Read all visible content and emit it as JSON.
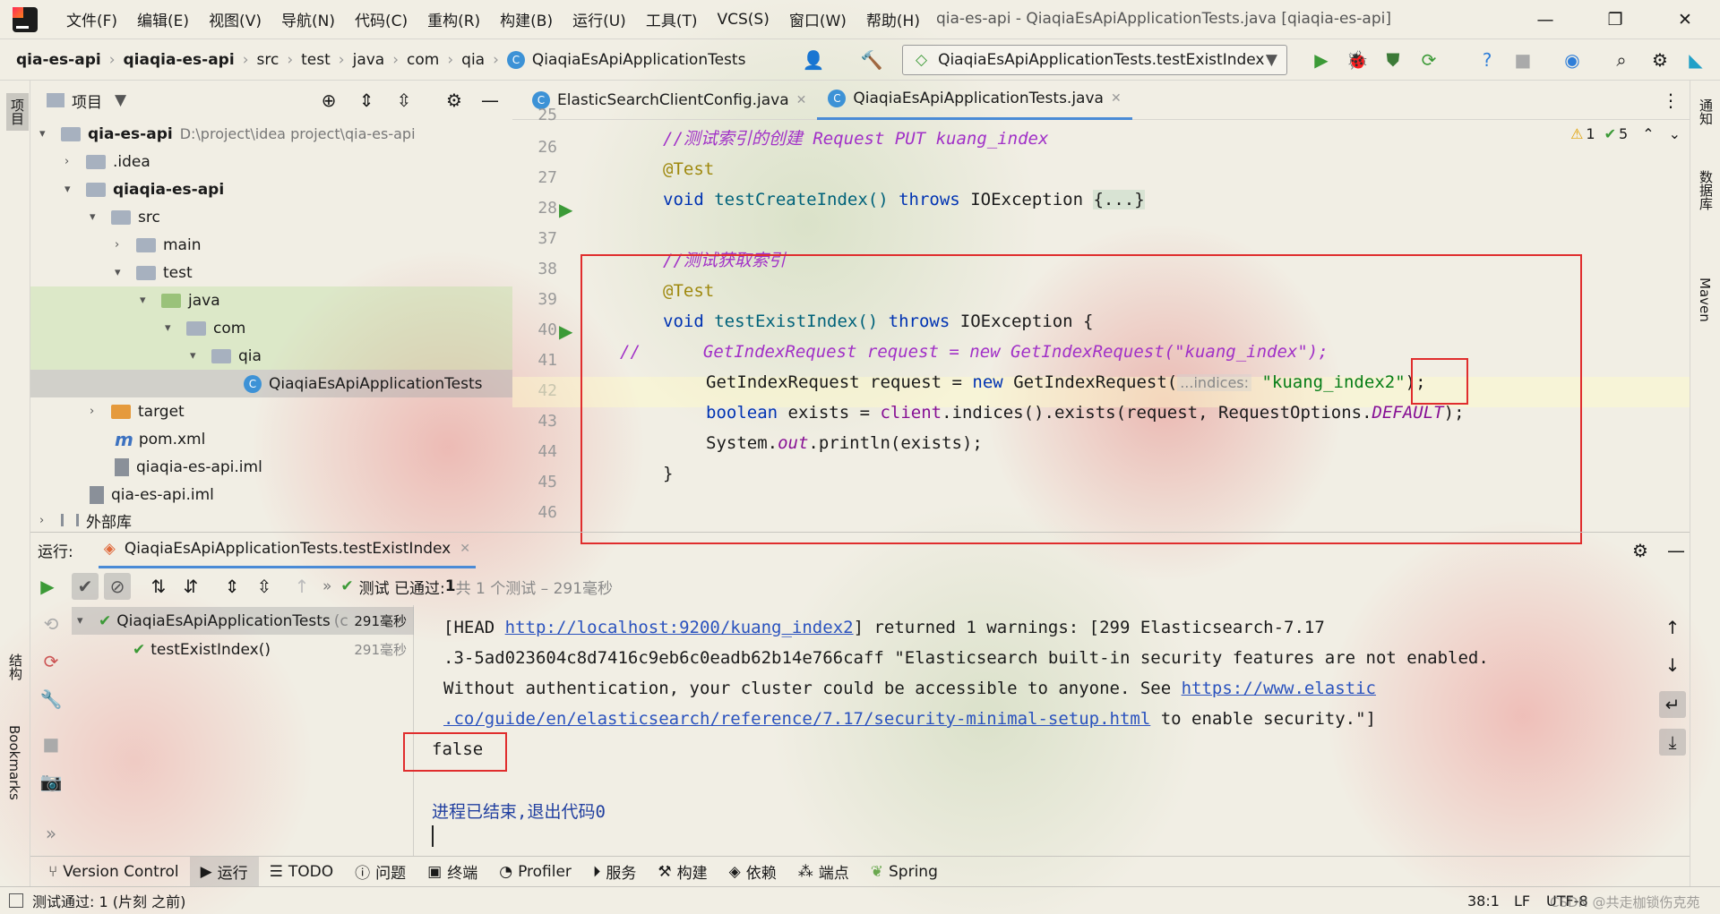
{
  "menu": [
    "文件(F)",
    "编辑(E)",
    "视图(V)",
    "导航(N)",
    "代码(C)",
    "重构(R)",
    "构建(B)",
    "运行(U)",
    "工具(T)",
    "VCS(S)",
    "窗口(W)",
    "帮助(H)"
  ],
  "window_title": "qia-es-api - QiaqiaEsApiApplicationTests.java [qiaqia-es-api]",
  "breadcrumb": [
    "qia-es-api",
    "qiaqia-es-api",
    "src",
    "test",
    "java",
    "com",
    "qia",
    "QiaqiaEsApiApplicationTests"
  ],
  "run_config": "QiaqiaEsApiApplicationTests.testExistIndex",
  "project_panel": {
    "title": "项目"
  },
  "tree": [
    {
      "label": "qia-es-api",
      "path": "D:\\project\\idea project\\qia-es-api"
    },
    {
      "label": ".idea"
    },
    {
      "label": "qiaqia-es-api"
    },
    {
      "label": "src"
    },
    {
      "label": "main"
    },
    {
      "label": "test"
    },
    {
      "label": "java"
    },
    {
      "label": "com"
    },
    {
      "label": "qia"
    },
    {
      "label": "QiaqiaEsApiApplicationTests"
    },
    {
      "label": "target"
    },
    {
      "label": "pom.xml"
    },
    {
      "label": "qiaqia-es-api.iml"
    },
    {
      "label": "qia-es-api.iml"
    },
    {
      "label": "外部库"
    }
  ],
  "tabs": [
    {
      "label": "ElasticSearchClientConfig.java"
    },
    {
      "label": "QiaqiaEsApiApplicationTests.java"
    }
  ],
  "inspections": {
    "warnings": "1",
    "ok": "5"
  },
  "line_numbers": [
    "25",
    "26",
    "27",
    "28",
    "37",
    "38",
    "39",
    "40",
    "41",
    "42",
    "43",
    "44",
    "45",
    "46"
  ],
  "code": {
    "l26": "//测试索引的创建 Request PUT kuang_index",
    "l27": "@Test",
    "l28_a": "void ",
    "l28_b": "testCreateIndex() ",
    "l28_c": "throws ",
    "l28_d": "IOException ",
    "l28_e": "{...}",
    "l38": "//测试获取索引",
    "l39": "@Test",
    "l40_a": "void ",
    "l40_b": "testExistIndex() ",
    "l40_c": "throws ",
    "l40_d": "IOException {",
    "l41_a": "//",
    "l41_b": "GetIndexRequest request = new GetIndexRequest(\"kuang_index\");",
    "l42_a": "GetIndexRequest request = ",
    "l42_b": "new ",
    "l42_c": "GetIndexRequest(",
    "l42_hint": "...indices:",
    "l42_d": "\"kuang_index2\"",
    "l42_e": ");",
    "l43_a": "boolean ",
    "l43_b": "exists = ",
    "l43_c": "client",
    "l43_d": ".indices().exists(request, RequestOptions.",
    "l43_e": "DEFAULT",
    "l43_f": ");",
    "l44_a": "System.",
    "l44_b": "out",
    "l44_c": ".println(exists);",
    "l45": "}"
  },
  "run": {
    "label": "运行:",
    "tab": "QiaqiaEsApiApplicationTests.testExistIndex",
    "status_a": "测试 已通过: ",
    "status_b": "1",
    "status_c": "共 1 个测试 – 291毫秒",
    "tests": [
      {
        "name": "QiaqiaEsApiApplicationTests",
        "extra": "(c",
        "time": "291毫秒"
      },
      {
        "name": "testExistIndex()",
        "time": "291毫秒"
      }
    ]
  },
  "console": {
    "l1_a": "[HEAD ",
    "l1_link": "http://localhost:9200/kuang_index2",
    "l1_b": "] returned 1 warnings: [299 Elasticsearch-7.17",
    "l2": ".3-5ad023604c8d7416c9eb6c0eadb62b14e766caff \"Elasticsearch built-in security features are not enabled.",
    "l3_a": "Without authentication, your cluster could be accessible to anyone. See ",
    "l3_link": "https://www.elastic",
    "l4_link": ".co/guide/en/elasticsearch/reference/7.17/security-minimal-setup.html",
    "l4_b": " to enable security.\"]",
    "l5": "false",
    "l6": "进程已结束,退出代码0"
  },
  "bottom_tabs": [
    "Version Control",
    "运行",
    "TODO",
    "问题",
    "终端",
    "Profiler",
    "服务",
    "构建",
    "依赖",
    "端点",
    "Spring"
  ],
  "status_bar": {
    "left": "测试通过: 1 (片刻 之前)",
    "pos": "38:1",
    "enc": "LF",
    "charset": "UTF-8",
    "watermark": "CSDN @共走枷锁伤克苑"
  },
  "side": {
    "left_top": "项目",
    "left_mid": "结构",
    "left_bot": "Bookmarks",
    "right1": "通知",
    "right2": "数据库",
    "right3": "Maven"
  }
}
